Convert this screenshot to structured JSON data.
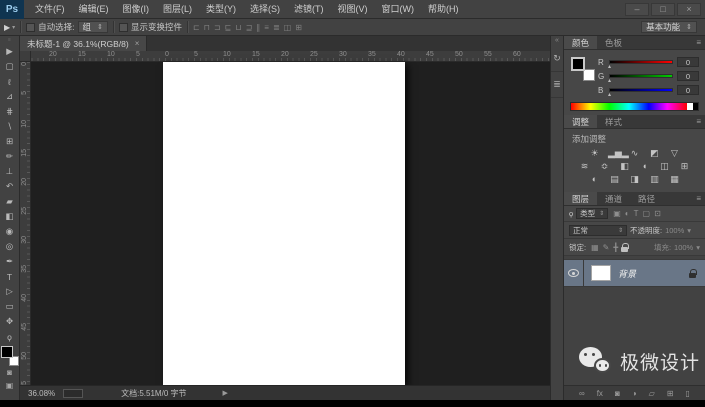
{
  "window": {
    "logo": "Ps",
    "minimize_icon": "–",
    "maximize_icon": "□",
    "close_icon": "×"
  },
  "menu_bar": [
    "文件(F)",
    "编辑(E)",
    "图像(I)",
    "图层(L)",
    "类型(Y)",
    "选择(S)",
    "滤镜(T)",
    "视图(V)",
    "窗口(W)",
    "帮助(H)"
  ],
  "options_bar": {
    "tool_icon": "▶",
    "preset_arrow": "▾",
    "auto_select_label": "自动选择:",
    "auto_select_value": "组",
    "select_arrow": "⇕",
    "transform_label": "显示变换控件",
    "align_icons": [
      {
        "name": "align-left-edges-icon",
        "glyph": "⊏"
      },
      {
        "name": "align-horizontal-centers-icon",
        "glyph": "⊓"
      },
      {
        "name": "align-right-edges-icon",
        "glyph": "⊐"
      },
      {
        "name": "align-top-edges-icon",
        "glyph": "⊑"
      },
      {
        "name": "align-vertical-centers-icon",
        "glyph": "⊔"
      },
      {
        "name": "align-bottom-edges-icon",
        "glyph": "⊒"
      },
      {
        "name": "distribute-left-icon",
        "glyph": "∥"
      },
      {
        "name": "distribute-centers-icon",
        "glyph": "≡"
      },
      {
        "name": "distribute-right-icon",
        "glyph": "≣"
      },
      {
        "name": "auto-align-layers-icon",
        "glyph": "◫"
      },
      {
        "name": "arrange-3d-icon",
        "glyph": "⊞"
      }
    ],
    "workspace_label": "基本功能",
    "workspace_arrow": "⇕"
  },
  "toolbar": {
    "grip_icon": "≡",
    "tools": [
      {
        "name": "move-tool",
        "glyph": "▶"
      },
      {
        "name": "rectangular-marquee-tool",
        "glyph": "▢"
      },
      {
        "name": "lasso-tool",
        "glyph": "ℓ"
      },
      {
        "name": "quick-selection-tool",
        "glyph": "⊿"
      },
      {
        "name": "crop-tool",
        "glyph": "⋕"
      },
      {
        "name": "eyedropper-tool",
        "glyph": "∖"
      },
      {
        "name": "spot-healing-brush-tool",
        "glyph": "⊞"
      },
      {
        "name": "brush-tool",
        "glyph": "✏"
      },
      {
        "name": "clone-stamp-tool",
        "glyph": "⊥"
      },
      {
        "name": "history-brush-tool",
        "glyph": "↶"
      },
      {
        "name": "eraser-tool",
        "glyph": "▰"
      },
      {
        "name": "gradient-tool",
        "glyph": "◧"
      },
      {
        "name": "blur-tool",
        "glyph": "◉"
      },
      {
        "name": "dodge-tool",
        "glyph": "◎"
      },
      {
        "name": "pen-tool",
        "glyph": "✒"
      },
      {
        "name": "type-tool",
        "glyph": "T"
      },
      {
        "name": "path-selection-tool",
        "glyph": "▷"
      },
      {
        "name": "shape-tool",
        "glyph": "▭"
      },
      {
        "name": "hand-tool",
        "glyph": "✥"
      },
      {
        "name": "zoom-tool",
        "glyph": "ϙ"
      }
    ],
    "quick_mask_icon": "◙",
    "screen_mode_icon": "▣"
  },
  "document": {
    "tab_title": "未标题-1 @ 36.1%(RGB/8)",
    "tab_close_icon": "×",
    "ruler_h": [
      {
        "label": "20",
        "style": "left:27px"
      },
      {
        "label": "15",
        "style": "left:56px"
      },
      {
        "label": "10",
        "style": "left:85px"
      },
      {
        "label": "5",
        "style": "left:114px"
      },
      {
        "label": "0",
        "style": "left:143px"
      },
      {
        "label": "5",
        "style": "left:172px"
      },
      {
        "label": "10",
        "style": "left:201px"
      },
      {
        "label": "15",
        "style": "left:230px"
      },
      {
        "label": "20",
        "style": "left:259px"
      },
      {
        "label": "25",
        "style": "left:288px"
      },
      {
        "label": "30",
        "style": "left:317px"
      },
      {
        "label": "35",
        "style": "left:346px"
      },
      {
        "label": "40",
        "style": "left:375px"
      },
      {
        "label": "45",
        "style": "left:404px"
      },
      {
        "label": "50",
        "style": "left:433px"
      },
      {
        "label": "55",
        "style": "left:462px"
      },
      {
        "label": "60",
        "style": "left:491px"
      }
    ],
    "ruler_v": [
      {
        "label": "0",
        "style": "top:0px"
      },
      {
        "label": "5",
        "style": "top:29px"
      },
      {
        "label": "10",
        "style": "top:58px"
      },
      {
        "label": "15",
        "style": "top:87px"
      },
      {
        "label": "20",
        "style": "top:116px"
      },
      {
        "label": "25",
        "style": "top:145px"
      },
      {
        "label": "30",
        "style": "top:174px"
      },
      {
        "label": "35",
        "style": "top:203px"
      },
      {
        "label": "40",
        "style": "top:232px"
      },
      {
        "label": "45",
        "style": "top:261px"
      },
      {
        "label": "50",
        "style": "top:290px"
      },
      {
        "label": "55",
        "style": "top:319px"
      }
    ]
  },
  "status_bar": {
    "zoom": "36.08%",
    "doc_info": "文档:5.51M/0 字节",
    "expand_icon": "▶"
  },
  "dock": {
    "collapse_icon": "«",
    "buttons": [
      {
        "name": "history-panel-icon",
        "glyph": "↻"
      },
      {
        "name": "properties-panel-icon",
        "glyph": "≣"
      }
    ]
  },
  "color_panel": {
    "tab_color": "颜色",
    "tab_swatches": "色板",
    "menu_icon": "≡",
    "channels": [
      {
        "label": "R",
        "value": "0",
        "thumb": "▴",
        "track_style": "background:linear-gradient(90deg,#000,#f00)"
      },
      {
        "label": "G",
        "value": "0",
        "thumb": "▴",
        "track_style": "background:linear-gradient(90deg,#000,#0c0)"
      },
      {
        "label": "B",
        "value": "0",
        "thumb": "▴",
        "track_style": "background:linear-gradient(90deg,#000,#00f)"
      }
    ]
  },
  "adjustments_panel": {
    "tab_adjustments": "调整",
    "tab_styles": "样式",
    "menu_icon": "≡",
    "hint": "添加调整",
    "row1": [
      {
        "name": "brightness-contrast-icon",
        "glyph": "☀"
      },
      {
        "name": "levels-icon",
        "glyph": "▂▅▂"
      },
      {
        "name": "curves-icon",
        "glyph": "∿"
      },
      {
        "name": "exposure-icon",
        "glyph": "◩"
      },
      {
        "name": "vibrance-icon",
        "glyph": "▽"
      }
    ],
    "row2": [
      {
        "name": "hue-saturation-icon",
        "glyph": "≋"
      },
      {
        "name": "color-balance-icon",
        "glyph": "≎"
      },
      {
        "name": "black-white-icon",
        "glyph": "◧"
      },
      {
        "name": "photo-filter-icon",
        "glyph": "◖"
      },
      {
        "name": "channel-mixer-icon",
        "glyph": "◫"
      },
      {
        "name": "color-lookup-icon",
        "glyph": "⊞"
      }
    ],
    "row3": [
      {
        "name": "invert-icon",
        "glyph": "◐"
      },
      {
        "name": "posterize-icon",
        "glyph": "▤"
      },
      {
        "name": "threshold-icon",
        "glyph": "◨"
      },
      {
        "name": "gradient-map-icon",
        "glyph": "▥"
      },
      {
        "name": "selective-color-icon",
        "glyph": "▦"
      }
    ]
  },
  "layers_panel": {
    "tab_layers": "图层",
    "tab_channels": "通道",
    "tab_paths": "路径",
    "menu_icon": "≡",
    "search_icon": "ϙ",
    "filter_type_label": "类型",
    "filter_arrow": "⇕",
    "filter_icons": [
      {
        "name": "filter-pixel-layers-icon",
        "glyph": "▣"
      },
      {
        "name": "filter-adjustment-layers-icon",
        "glyph": "◐"
      },
      {
        "name": "filter-type-layers-icon",
        "glyph": "T"
      },
      {
        "name": "filter-shape-layers-icon",
        "glyph": "▢"
      },
      {
        "name": "filter-smart-objects-icon",
        "glyph": "⊡"
      }
    ],
    "blend_mode": "正常",
    "blend_arrow": "⇕",
    "opacity_label": "不透明度:",
    "opacity_value": "100%",
    "opacity_arrow": "▾",
    "lock_label": "锁定:",
    "lock_icons": [
      {
        "name": "lock-transparent-pixels-icon",
        "glyph": "▦"
      },
      {
        "name": "lock-image-pixels-icon",
        "glyph": "✎"
      },
      {
        "name": "lock-position-icon",
        "glyph": "╋"
      }
    ],
    "fill_label": "填充:",
    "fill_value": "100%",
    "fill_arrow": "▾",
    "layer_name": "背景",
    "bottom_icons": [
      {
        "name": "link-layers-icon",
        "glyph": "∞"
      },
      {
        "name": "layer-style-icon",
        "glyph": "fx"
      },
      {
        "name": "layer-mask-icon",
        "glyph": "◙"
      },
      {
        "name": "new-adjustment-layer-icon",
        "glyph": "◑"
      },
      {
        "name": "new-group-icon",
        "glyph": "▱"
      },
      {
        "name": "new-layer-icon",
        "glyph": "⊞"
      },
      {
        "name": "delete-layer-icon",
        "glyph": "▯"
      }
    ]
  },
  "watermark": {
    "text": "极微设计"
  }
}
